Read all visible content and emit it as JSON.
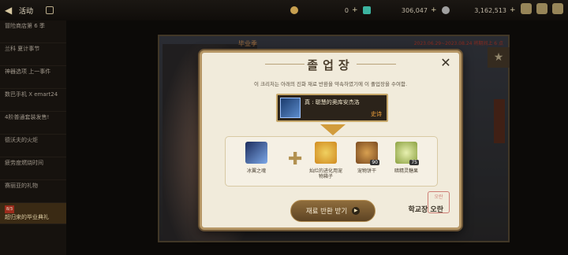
{
  "topbar": {
    "title": "活动",
    "gold_amount": "0",
    "gem_amount": "306,047",
    "coin_amount": "3,162,513"
  },
  "sidebar": {
    "items": [
      {
        "label": "冒险商店第 6 季"
      },
      {
        "label": "兰科 夏计事节"
      },
      {
        "label": "神器选项 上一事件"
      },
      {
        "label": "数巴手机 X emart24"
      },
      {
        "label": "4阶普通套装发售!"
      },
      {
        "label": "德沃夫的火炬"
      },
      {
        "label": "疲劳度燃烧时间"
      },
      {
        "label": "赛丽亚的礼物"
      },
      {
        "tag": "8/3",
        "label": "超归来的毕业典礼",
        "active": true
      }
    ]
  },
  "background_event": {
    "title": "毕业季",
    "date_range": "2023.06.29~2023.08.24  将期间上 6 点"
  },
  "modal": {
    "title": "졸업장",
    "subtitle": "이 크리처는 아래의 진화 재료 반환을 약속하였기에 이 졸업장을 수여함.",
    "target": {
      "name": "真 : 聪慧的奥库安杰洛",
      "grade": "史诗"
    },
    "materials": [
      {
        "label": "冰翼之魂",
        "icon": "ice-wing-soul-icon"
      },
      {
        "label": "灿烂的进化用宠物箱子",
        "icon": "evolution-pet-box-icon"
      },
      {
        "label": "宠物饼干",
        "icon": "pet-cookie-icon",
        "count": "90"
      },
      {
        "label": "暗精灵糖果",
        "icon": "dark-elf-candy-icon",
        "count": "75"
      }
    ],
    "claim_button": "재료 반환 받기",
    "signature": "학교장 오란",
    "stamp_text": "오란"
  }
}
